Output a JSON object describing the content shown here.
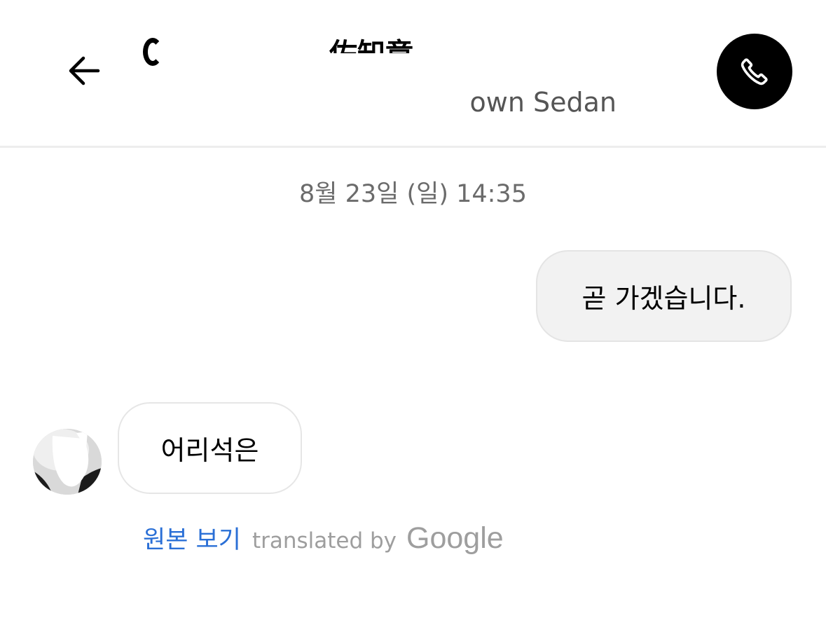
{
  "header": {
    "driver_name": "佐知章",
    "vehicle": "own Sedan"
  },
  "chat": {
    "date": "8월 23일 (일) 14:35",
    "outgoing_message": "곧 가겠습니다.",
    "incoming_message": "어리석은"
  },
  "translation": {
    "show_original": "원본 보기",
    "translated_by": "translated by",
    "provider": "Google"
  },
  "colors": {
    "accent_link": "#2a6fd6",
    "call_button": "#000000",
    "outgoing_bubble": "#f2f2f2"
  },
  "icons": {
    "back": "back-arrow-icon",
    "call": "phone-icon"
  }
}
